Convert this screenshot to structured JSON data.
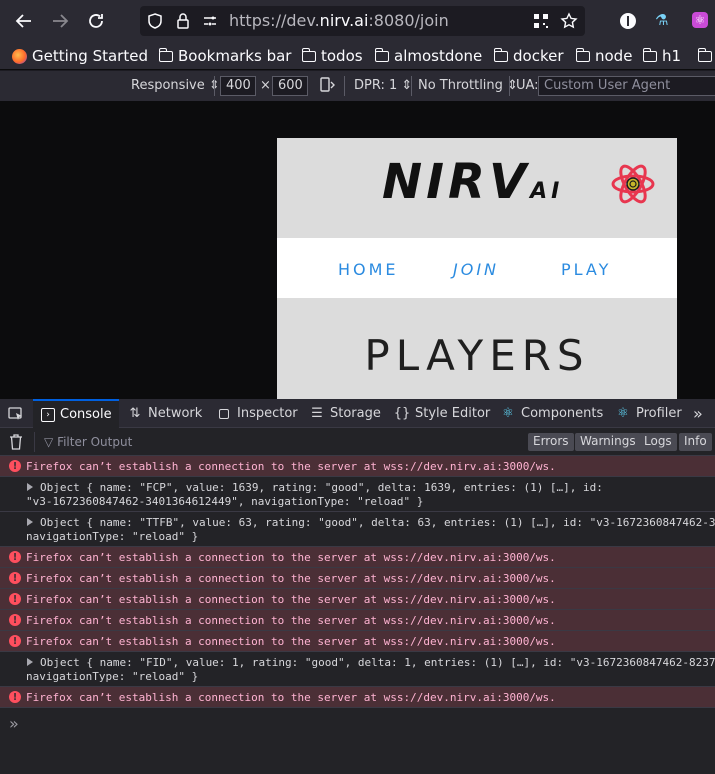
{
  "browser": {
    "url_prefix": "https://dev.",
    "url_host": "nirv.ai",
    "url_suffix": ":8080/join",
    "bookmarks": [
      "Getting Started",
      "Bookmarks bar",
      "todos",
      "almostdone",
      "docker",
      "node",
      "h1"
    ]
  },
  "rdm": {
    "device": "Responsive",
    "width": "400",
    "times": "×",
    "height": "600",
    "dpr": "DPR: 1",
    "throttling": "No Throttling",
    "ua_label": "UA:",
    "ua_placeholder": "Custom User Agent"
  },
  "site": {
    "logo_main": "NIRV",
    "logo_ai": "AI",
    "nav": [
      "HOME",
      "JOIN",
      "PLAY"
    ],
    "hero_title": "PLAYERS",
    "colors": {
      "link": "#2b8be0",
      "header_bg": "#dcdcdc"
    }
  },
  "devtools": {
    "tabs": [
      "Console",
      "Network",
      "Inspector",
      "Storage",
      "Style Editor",
      "Components",
      "Profiler"
    ],
    "filter_placeholder": "Filter Output",
    "filter_buttons": [
      "Errors",
      "Warnings",
      "Logs",
      "Info"
    ],
    "error_message": "Firefox can’t establish a connection to the server at wss://dev.nirv.ai:3000/ws.",
    "obj_fcp_line1": "Object { name: \"FCP\", value: 1639, rating: \"good\", delta: 1639, entries: (1) […], id:",
    "obj_fcp_line2": "\"v3-1672360847462-3401364612449\", navigationType: \"reload\" }",
    "obj_ttfb_line1": "Object { name: \"TTFB\", value: 63, rating: \"good\", delta: 63, entries: (1) […], id: \"v3-1672360847462-3",
    "obj_ttfb_line2": "navigationType: \"reload\" }",
    "obj_fid_line1": "Object { name: \"FID\", value: 1, rating: \"good\", delta: 1, entries: (1) […], id: \"v3-1672360847462-8237",
    "obj_fid_line2": "navigationType: \"reload\" }",
    "prompt": "»"
  }
}
